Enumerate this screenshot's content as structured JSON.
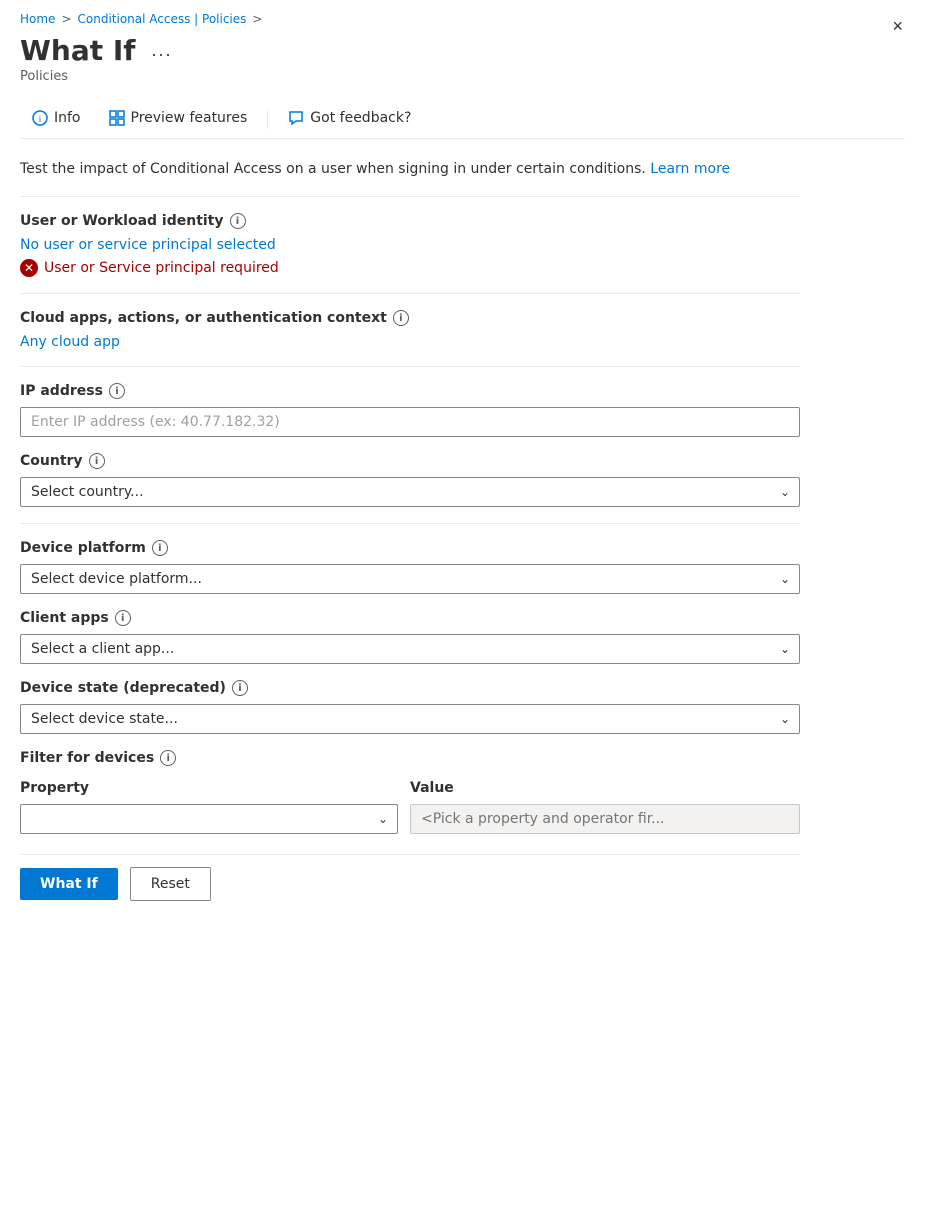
{
  "breadcrumb": {
    "home": "Home",
    "conditional_access": "Conditional Access | Policies",
    "sep1": ">",
    "sep2": ">"
  },
  "header": {
    "title": "What If",
    "more_label": "...",
    "subtitle": "Policies",
    "close_icon": "×"
  },
  "tabs": [
    {
      "id": "info",
      "label": "Info",
      "icon": "ℹ"
    },
    {
      "id": "preview",
      "label": "Preview features",
      "icon": "⊞"
    },
    {
      "id": "feedback",
      "label": "Got feedback?",
      "icon": "💬"
    }
  ],
  "description": {
    "text": "Test the impact of Conditional Access on a user when signing in under certain conditions.",
    "learn_more": "Learn more"
  },
  "user_identity": {
    "label": "User or Workload identity",
    "link_text": "No user or service principal selected",
    "error_text": "User or Service principal required"
  },
  "cloud_apps": {
    "label": "Cloud apps, actions, or authentication context",
    "value": "Any cloud app"
  },
  "ip_address": {
    "label": "IP address",
    "placeholder": "Enter IP address (ex: 40.77.182.32)"
  },
  "country": {
    "label": "Country",
    "placeholder": "Select country...",
    "options": [
      "Select country..."
    ]
  },
  "device_platform": {
    "label": "Device platform",
    "placeholder": "Select device platform...",
    "options": [
      "Select device platform..."
    ]
  },
  "client_apps": {
    "label": "Client apps",
    "placeholder": "Select a client app...",
    "options": [
      "Select a client app..."
    ]
  },
  "device_state": {
    "label": "Device state (deprecated)",
    "placeholder": "Select device state...",
    "options": [
      "Select device state..."
    ]
  },
  "filter_devices": {
    "label": "Filter for devices",
    "property_col": "Property",
    "value_col": "Value",
    "property_placeholder": "",
    "value_placeholder": "<Pick a property and operator fir..."
  },
  "actions": {
    "what_if_label": "What If",
    "reset_label": "Reset"
  }
}
